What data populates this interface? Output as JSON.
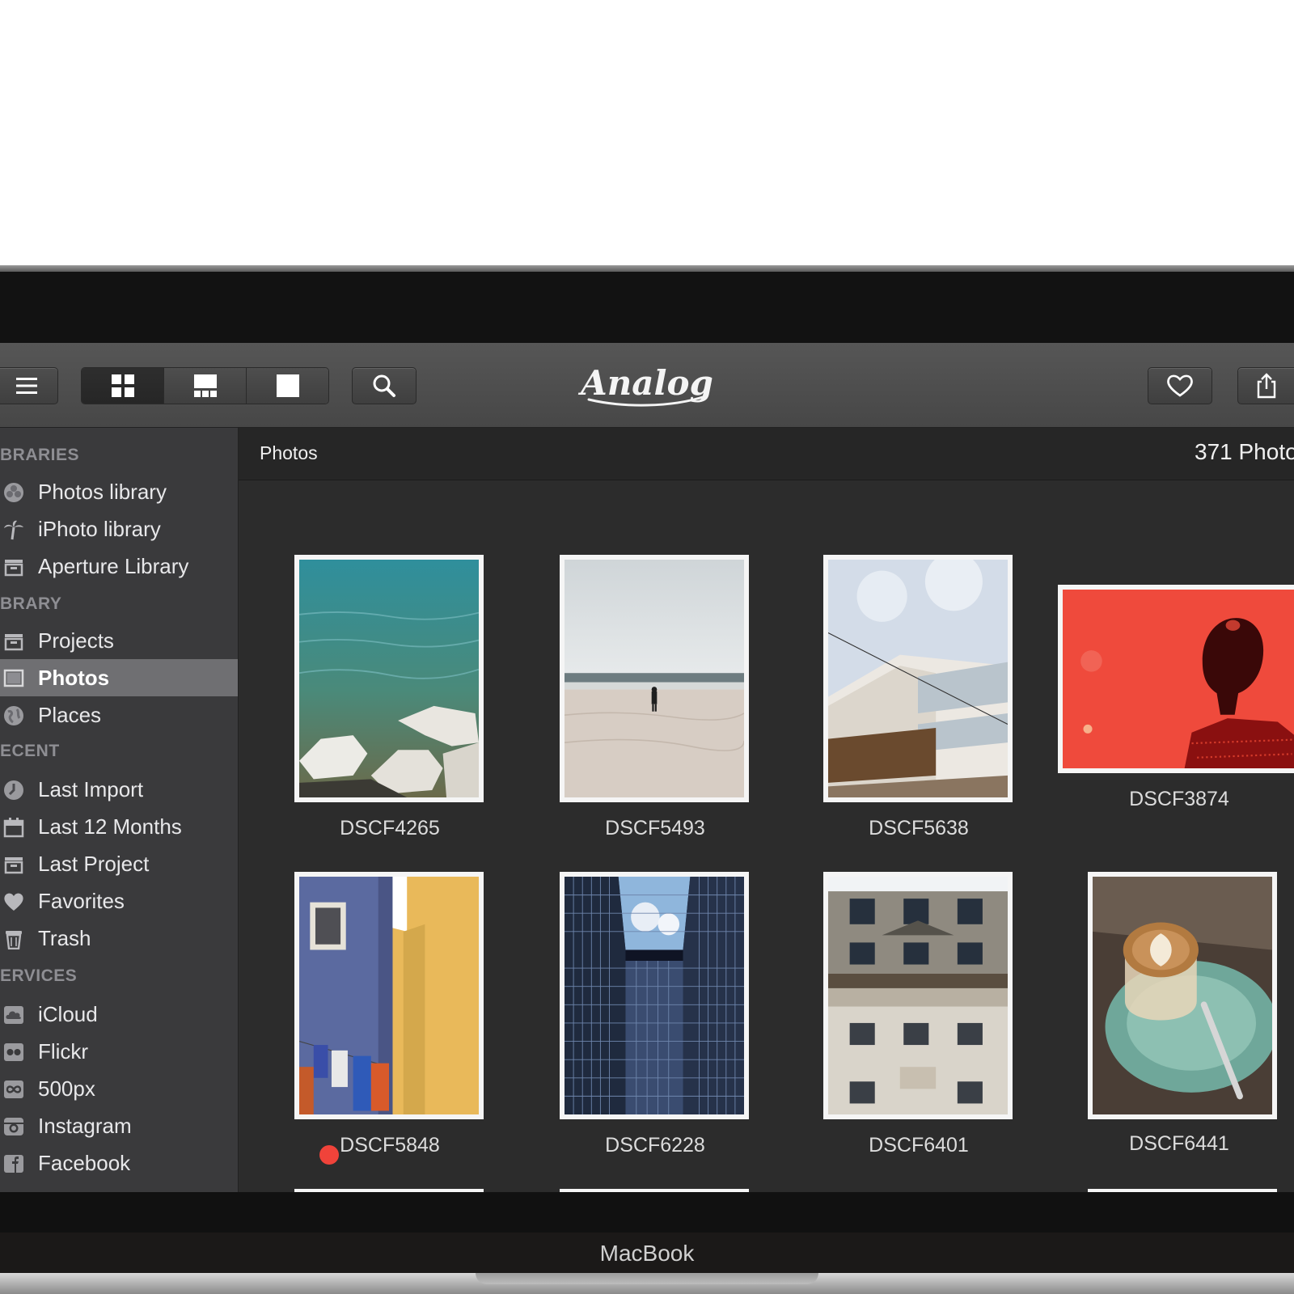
{
  "app": {
    "logo_text": "Analog"
  },
  "toolbar": {
    "menu_icon": "hamburger-icon",
    "view_modes": [
      "grid-icon",
      "mosaic-icon",
      "single-icon"
    ],
    "search_icon": "search-icon",
    "favorite_icon": "heart-icon",
    "share_icon": "share-icon"
  },
  "sidebar": {
    "sections": [
      {
        "header": "BRARIES",
        "items": [
          {
            "label": "Photos library",
            "icon": "photos-icon"
          },
          {
            "label": "iPhoto library",
            "icon": "palm-tree-icon"
          },
          {
            "label": "Aperture Library",
            "icon": "aperture-box-icon"
          }
        ]
      },
      {
        "header": "BRARY",
        "items": [
          {
            "label": "Projects",
            "icon": "projects-box-icon"
          },
          {
            "label": "Photos",
            "icon": "photo-frame-icon",
            "selected": true
          },
          {
            "label": "Places",
            "icon": "globe-icon"
          }
        ]
      },
      {
        "header": "ECENT",
        "items": [
          {
            "label": "Last Import",
            "icon": "import-clock-icon"
          },
          {
            "label": "Last 12 Months",
            "icon": "calendar-icon"
          },
          {
            "label": "Last Project",
            "icon": "last-project-box-icon"
          },
          {
            "label": "Favorites",
            "icon": "heart-icon"
          },
          {
            "label": "Trash",
            "icon": "trash-icon"
          }
        ]
      },
      {
        "header": "ERVICES",
        "items": [
          {
            "label": "iCloud",
            "icon": "cloud-icon"
          },
          {
            "label": "Flickr",
            "icon": "flickr-icon"
          },
          {
            "label": "500px",
            "icon": "infinity-icon"
          },
          {
            "label": "Instagram",
            "icon": "camera-icon"
          },
          {
            "label": "Facebook",
            "icon": "facebook-icon"
          }
        ]
      }
    ]
  },
  "main": {
    "title": "Photos",
    "count": "371 Photo",
    "photos": [
      {
        "name": "DSCF4265"
      },
      {
        "name": "DSCF5493"
      },
      {
        "name": "DSCF5638"
      },
      {
        "name": "DSCF3874"
      },
      {
        "name": "DSCF5848",
        "label_color": "#f0433a"
      },
      {
        "name": "DSCF6228"
      },
      {
        "name": "DSCF6401"
      },
      {
        "name": "DSCF6441"
      }
    ]
  },
  "device": {
    "brand": "MacBook"
  }
}
